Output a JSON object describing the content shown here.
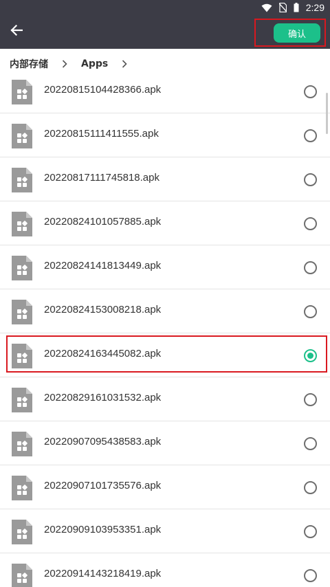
{
  "status": {
    "time": "2:29",
    "icons": [
      "wifi-icon",
      "no-sim-icon",
      "battery-icon"
    ]
  },
  "toolbar": {
    "back_icon": "arrow-left-icon",
    "confirm_label": "确认"
  },
  "breadcrumb": {
    "items": [
      "内部存储",
      "Apps"
    ]
  },
  "files": [
    {
      "name": "20220815104428366.apk",
      "selected": false
    },
    {
      "name": "20220815111411555.apk",
      "selected": false
    },
    {
      "name": "20220817111745818.apk",
      "selected": false
    },
    {
      "name": "20220824101057885.apk",
      "selected": false
    },
    {
      "name": "20220824141813449.apk",
      "selected": false
    },
    {
      "name": "20220824153008218.apk",
      "selected": false
    },
    {
      "name": "20220824163445082.apk",
      "selected": true
    },
    {
      "name": "20220829161031532.apk",
      "selected": false
    },
    {
      "name": "20220907095438583.apk",
      "selected": false
    },
    {
      "name": "20220907101735576.apk",
      "selected": false
    },
    {
      "name": "20220909103953351.apk",
      "selected": false
    },
    {
      "name": "20220914143218419.apk",
      "selected": false
    }
  ],
  "colors": {
    "header": "#3c3c46",
    "accent": "#1cc08a",
    "highlight": "#d9181f"
  }
}
